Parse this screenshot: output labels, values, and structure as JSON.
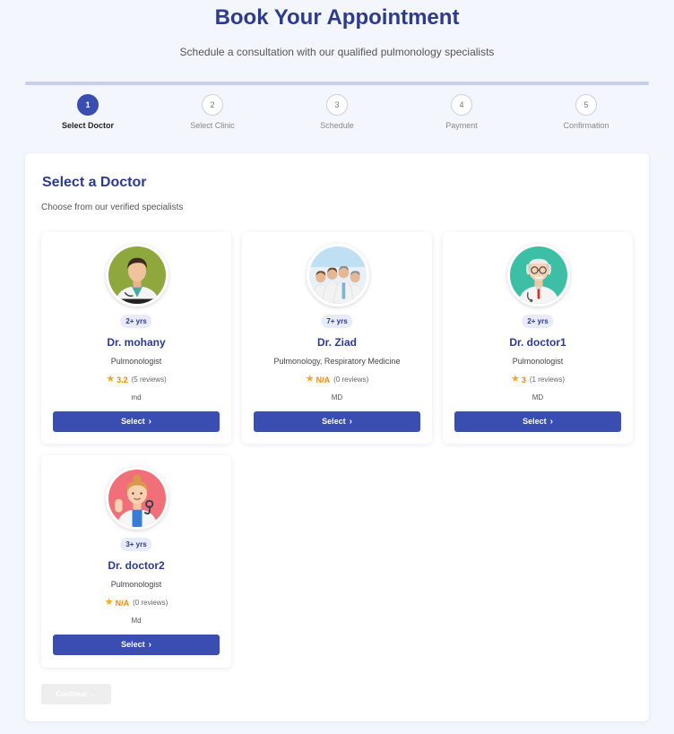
{
  "header": {
    "title": "Book Your Appointment",
    "subtitle": "Schedule a consultation with our qualified pulmonology specialists"
  },
  "steps": [
    {
      "number": "1",
      "label": "Select Doctor",
      "active": true
    },
    {
      "number": "2",
      "label": "Select Clinic",
      "active": false
    },
    {
      "number": "3",
      "label": "Schedule",
      "active": false
    },
    {
      "number": "4",
      "label": "Payment",
      "active": false
    },
    {
      "number": "5",
      "label": "Confirmation",
      "active": false
    }
  ],
  "panel": {
    "title": "Select a Doctor",
    "subtitle": "Choose from our verified specialists"
  },
  "doctors": [
    {
      "experience": "2+ yrs",
      "name": "Dr. mohany",
      "specialty": "Pulmonologist",
      "rating": "3.2",
      "reviews": "(5 reviews)",
      "degree": "md",
      "button": "Select",
      "avatar": "male-doctor-icon"
    },
    {
      "experience": "7+ yrs",
      "name": "Dr. Ziad",
      "specialty": "Pulmonology, Respiratory Medicine",
      "rating": "N/A",
      "reviews": "(0 reviews)",
      "degree": "MD",
      "button": "Select",
      "avatar": "medical-team-photo"
    },
    {
      "experience": "2+ yrs",
      "name": "Dr. doctor1",
      "specialty": "Pulmonologist",
      "rating": "3",
      "reviews": "(1 reviews)",
      "degree": "MD",
      "button": "Select",
      "avatar": "senior-doctor-icon"
    },
    {
      "experience": "3+ yrs",
      "name": "Dr. doctor2",
      "specialty": "Pulmonologist",
      "rating": "N/A",
      "reviews": "(0 reviews)",
      "degree": "Md",
      "button": "Select",
      "avatar": "female-doctor-icon"
    }
  ],
  "continue_button": {
    "label": "Continue",
    "enabled": false
  },
  "colors": {
    "primary": "#3a4db0",
    "heading": "#2e3a8c",
    "star": "#f5a623",
    "background": "#f3f6fd"
  }
}
